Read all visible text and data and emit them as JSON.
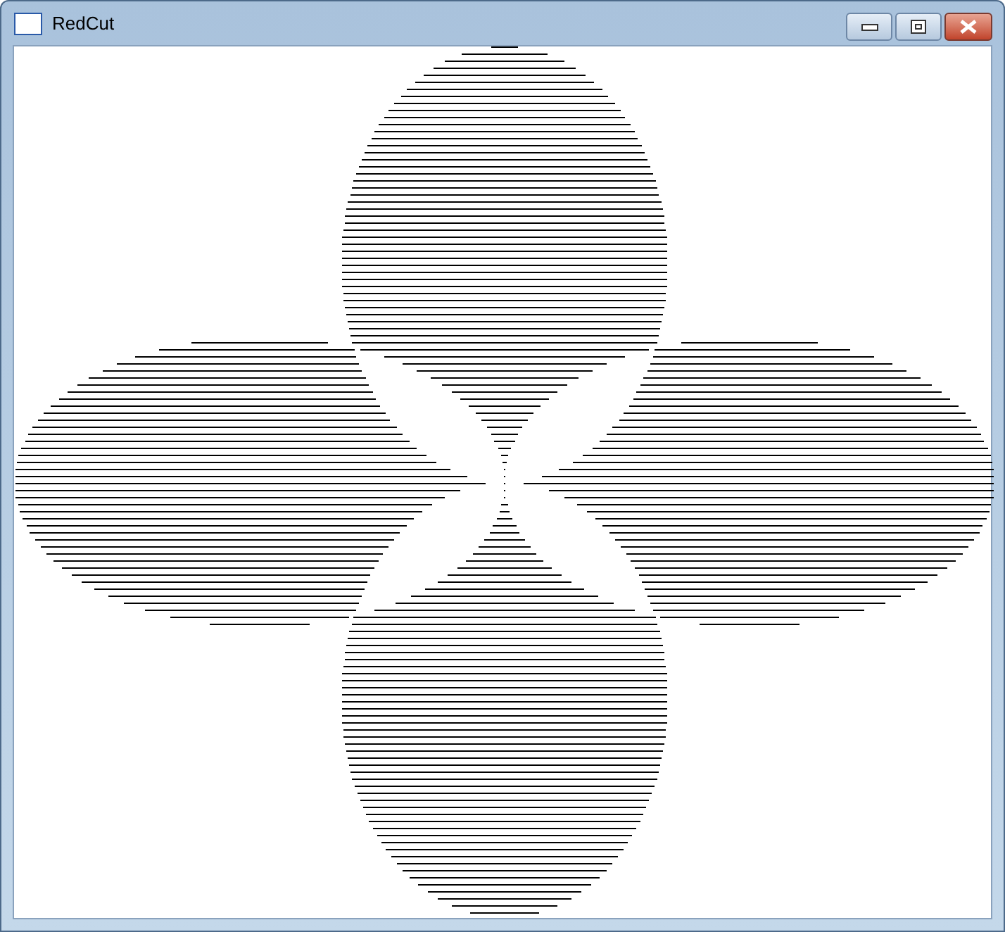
{
  "window": {
    "title": "RedCut"
  }
}
